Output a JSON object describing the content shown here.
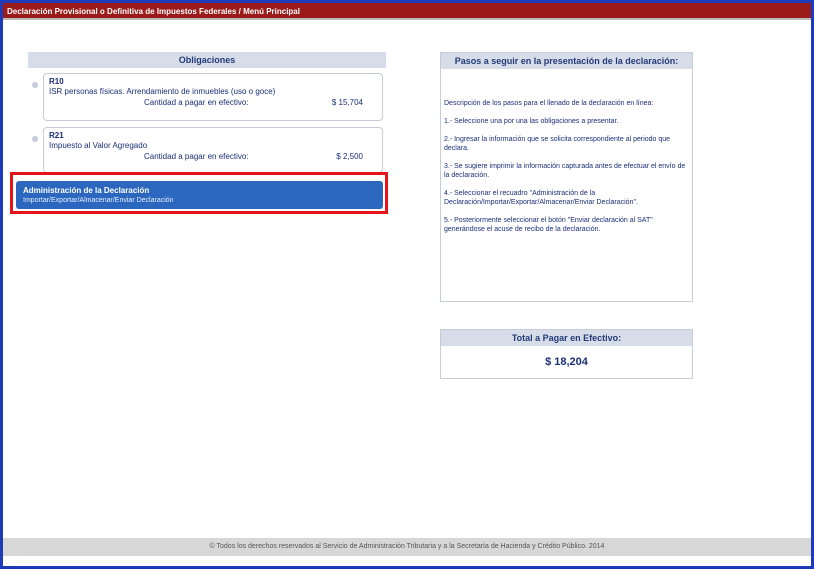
{
  "window": {
    "title": "Declaración Provisional o Definitiva de Impuestos Federales / Menú Principal"
  },
  "obligaciones": {
    "header": "Obligaciones",
    "items": [
      {
        "code": "R10",
        "description": "ISR personas físicas. Arrendamiento de inmuebles (uso o goce)",
        "amount_label": "Cantidad a pagar en efectivo:",
        "amount": "$ 15,704"
      },
      {
        "code": "R21",
        "description": "Impuesto al Valor Agregado",
        "amount_label": "Cantidad a pagar en efectivo:",
        "amount": "$ 2,500"
      }
    ]
  },
  "admin": {
    "title": "Administración de la Declaración",
    "subtitle": "Importar/Exportar/Almacenar/Enviar Declaración"
  },
  "pasos": {
    "header": "Pasos a seguir en la presentación de la declaración:",
    "steps": [
      "Descripción de los pasos para el llenado de la declaración en línea:",
      "1.- Seleccione una por una las obligaciones a presentar.",
      "2.- Ingresar la información que se solicita correspondiente al periodo que declara.",
      "3.- Se sugiere imprimir la información capturada antes de efectuar el envío de la declaración.",
      "4.- Seleccionar el recuadro \"Administración de la Declaración/Importar/Exportar/Almacenar/Enviar Declaración\".",
      "5.- Posteriormente seleccionar el botón \"Enviar declaración al SAT\" generándose el acuse de recibo de la declaración."
    ]
  },
  "total": {
    "header": "Total a Pagar en Efectivo:",
    "amount": "$ 18,204"
  },
  "footer": {
    "text": "© Todos los derechos reservados al Servicio de Administración Tributaria y a la Secretaría de Hacienda y Crédito Público. 2014"
  },
  "colors": {
    "frame": "#1d3ab8",
    "titlebar": "#9b1a1a",
    "header_bg": "#d7dde8",
    "admin_btn": "#2c67bf",
    "highlight": "#e4141b"
  }
}
